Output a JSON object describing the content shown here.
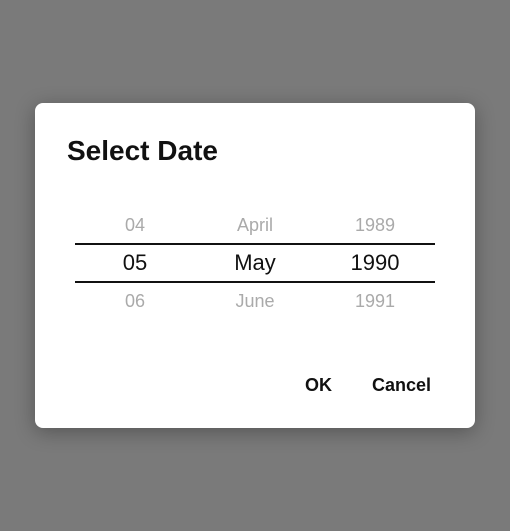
{
  "dialog": {
    "title": "Select Date"
  },
  "picker": {
    "day": {
      "prev": "04",
      "selected": "05",
      "next": "06"
    },
    "month": {
      "prev": "April",
      "selected": "May",
      "next": "June"
    },
    "year": {
      "prev": "1989",
      "selected": "1990",
      "next": "1991"
    }
  },
  "actions": {
    "ok_label": "OK",
    "cancel_label": "Cancel"
  }
}
